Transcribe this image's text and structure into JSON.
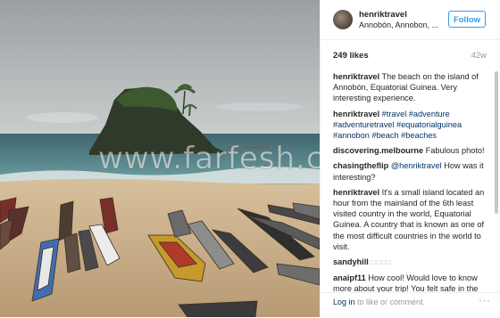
{
  "post": {
    "username": "henriktravel",
    "location": "Annobón, Annobon, ...",
    "follow_label": "Follow",
    "likes": "249 likes",
    "age": "42w"
  },
  "watermark": "www.farfesh.com",
  "comments": [
    {
      "user": "henriktravel",
      "text": "The beach on the island of Annobón, Equatorial Guinea. Very interesting experience."
    },
    {
      "user": "henriktravel",
      "tags": [
        "#travel",
        "#adventure",
        "#adventuretravel",
        "#equatorialguinea",
        "#annobon",
        "#beach",
        "#beaches"
      ]
    },
    {
      "user": "discovering.melbourne",
      "text": "Fabulous photo!"
    },
    {
      "user": "chasingtheflip",
      "mention": "@henriktravel",
      "text": "How was it interesting?"
    },
    {
      "user": "henriktravel",
      "text": "It's a small island located an hour from the mainland of the 6th least visited country in the world, Equatorial Guinea. A country that is known as one of the most difficult countries in the world to visit."
    },
    {
      "user": "sandyhill",
      "text": "□□□□"
    },
    {
      "user": "anaipf11",
      "text": "How cool! Would love to know more about your trip! You felt safe in the country?"
    }
  ],
  "footer": {
    "login_link": "Log in",
    "login_rest": " to like or comment.",
    "more": "···"
  }
}
